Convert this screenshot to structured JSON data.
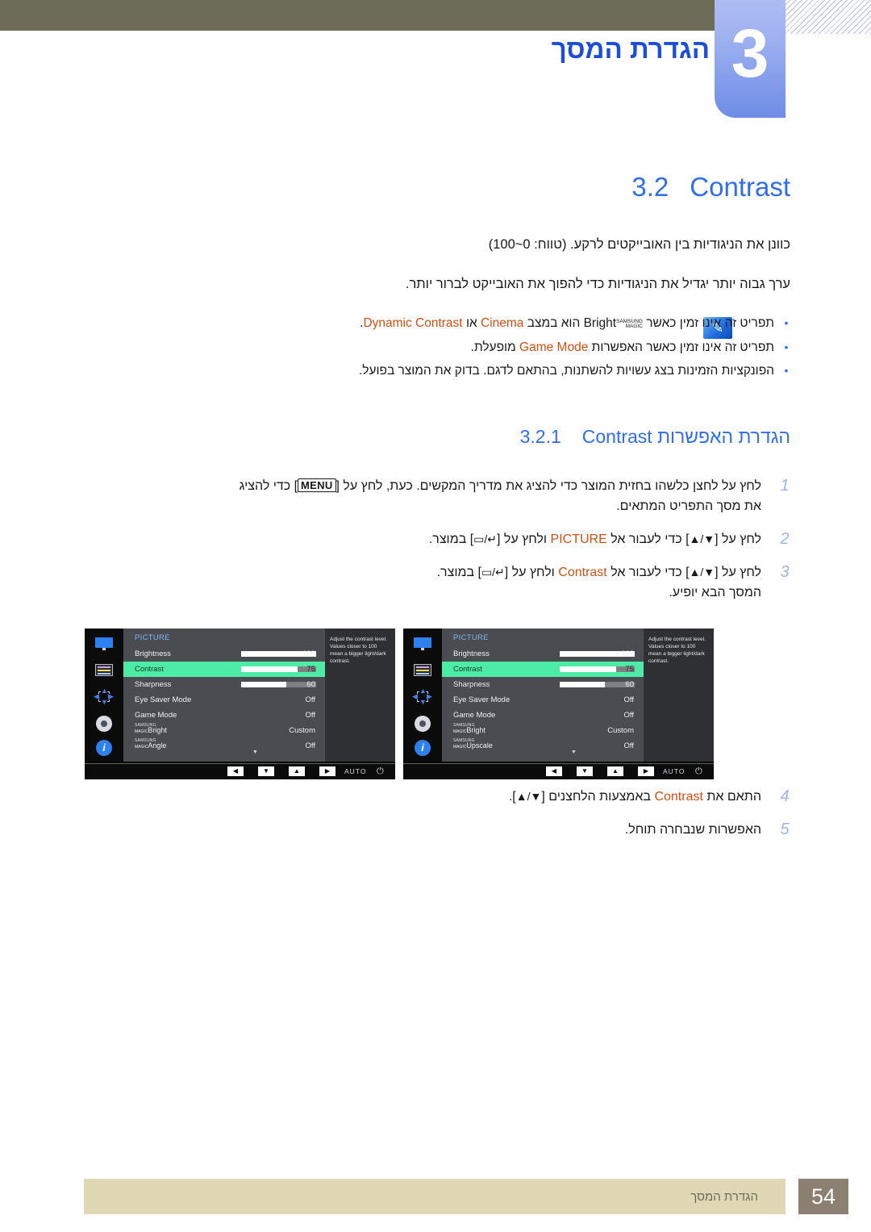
{
  "header": {
    "chapter_number": "3",
    "chapter_title": "הגדרת המסך"
  },
  "section": {
    "number": "3.2",
    "title": "Contrast"
  },
  "body": {
    "paragraph_1": "כוונן את הניגודיות בין האובייקטים לרקע. (טווח: 0~100)",
    "paragraph_2": "ערך גבוה יותר יגדיל את הניגודיות כדי להפוך את האובייקט לברור יותר."
  },
  "notes": {
    "icon": "note-icon",
    "items": [
      {
        "pre": "תפריט זה אינו זמין כאשר",
        "brand_small_1": "SAMSUNG",
        "brand_small_2": "MAGIC",
        "brand_word": "Bright",
        "mid": "הוא במצב",
        "highlight_1": "Cinema",
        "conj": "או",
        "highlight_2": "Dynamic Contrast",
        "post": "."
      },
      {
        "pre": "תפריט זה אינו זמין כאשר האפשרות",
        "highlight_1": "Game Mode",
        "post": "מופעלת."
      },
      {
        "text": "הפונקציות הזמינות בצג עשויות להשתנות, בהתאם לדגם. בדוק את המוצר בפועל."
      }
    ]
  },
  "subsection": {
    "number": "3.2.1",
    "title": "הגדרת האפשרות Contrast"
  },
  "steps": [
    {
      "number": "1",
      "line1_a": "לחץ על לחצן כלשהו בחזית המוצר כדי להציג את מדריך המקשים. כעת, לחץ על [",
      "key": "MENU",
      "line1_b": "] כדי להציג",
      "line2": "את מסך התפריט המתאים."
    },
    {
      "number": "2",
      "a": "לחץ על [",
      "keys": "▲/▼",
      "b": "] כדי לעבור אל",
      "highlight": "PICTURE",
      "c": "ולחץ על [",
      "keys2": "▭/↵",
      "d": "] במוצר."
    },
    {
      "number": "3",
      "a": "לחץ על [",
      "keys": "▲/▼",
      "b": "] כדי לעבור אל",
      "highlight": "Contrast",
      "c": "ולחץ על [",
      "keys2": "▭/↵",
      "d": "] במוצר.",
      "line2": "המסך הבא יופיע."
    }
  ],
  "steps_after": [
    {
      "number": "4",
      "a": "התאם את",
      "highlight": "Contrast",
      "b": "באמצעות הלחצנים [",
      "keys": "▲/▼",
      "c": "]."
    },
    {
      "number": "5",
      "text": "האפשרות שנבחרה תוחל."
    }
  ],
  "osd": {
    "title": "PICTURE",
    "help_text": "Adjust the contrast level. Values closer to 100 mean a bigger light/dark contrast.",
    "sidebar_icons": [
      "monitor-icon",
      "osd-list-icon",
      "four-way-arrows-icon",
      "gear-icon",
      "info-icon"
    ],
    "caret": "▼",
    "buttons": {
      "left": "◀",
      "down": "▼",
      "up": "▲",
      "right": "▶",
      "auto": "AUTO",
      "power": "⏻"
    },
    "left_menu": {
      "rows": [
        {
          "label": "Brightness",
          "value": "100",
          "bar": 100,
          "selected": false
        },
        {
          "label": "Contrast",
          "value": "75",
          "bar": 75,
          "selected": true
        },
        {
          "label": "Sharpness",
          "value": "60",
          "bar": 60,
          "selected": false
        },
        {
          "label": "Eye Saver Mode",
          "value": "Off",
          "selected": false
        },
        {
          "label": "Game Mode",
          "value": "Off",
          "selected": false
        },
        {
          "label_brand_1": "SAMSUNG",
          "label_brand_2": "MAGIC",
          "label_word": "Bright",
          "value": "Custom",
          "selected": false
        },
        {
          "label_brand_1": "SAMSUNG",
          "label_brand_2": "MAGIC",
          "label_word": "Angle",
          "value": "Off",
          "selected": false
        }
      ]
    },
    "right_menu": {
      "rows": [
        {
          "label": "Brightness",
          "value": "100",
          "bar": 100,
          "selected": false
        },
        {
          "label": "Contrast",
          "value": "75",
          "bar": 75,
          "selected": true
        },
        {
          "label": "Sharpness",
          "value": "60",
          "bar": 60,
          "selected": false
        },
        {
          "label": "Eye Saver Mode",
          "value": "Off",
          "selected": false
        },
        {
          "label": "Game Mode",
          "value": "Off",
          "selected": false
        },
        {
          "label_brand_1": "SAMSUNG",
          "label_brand_2": "MAGIC",
          "label_word": "Bright",
          "value": "Custom",
          "selected": false
        },
        {
          "label_brand_1": "SAMSUNG",
          "label_brand_2": "MAGIC",
          "label_word": "Upscale",
          "value": "Off",
          "selected": false
        }
      ]
    }
  },
  "footer": {
    "text": "הגדרת המסך",
    "page_number": "54"
  },
  "colors": {
    "accent_blue": "#2f6ef0",
    "highlight_orange": "#d2500f",
    "header_olive": "#6d6c58",
    "footer_beige": "#e0d8b4",
    "osd_selected_green": "#4ceca7"
  }
}
